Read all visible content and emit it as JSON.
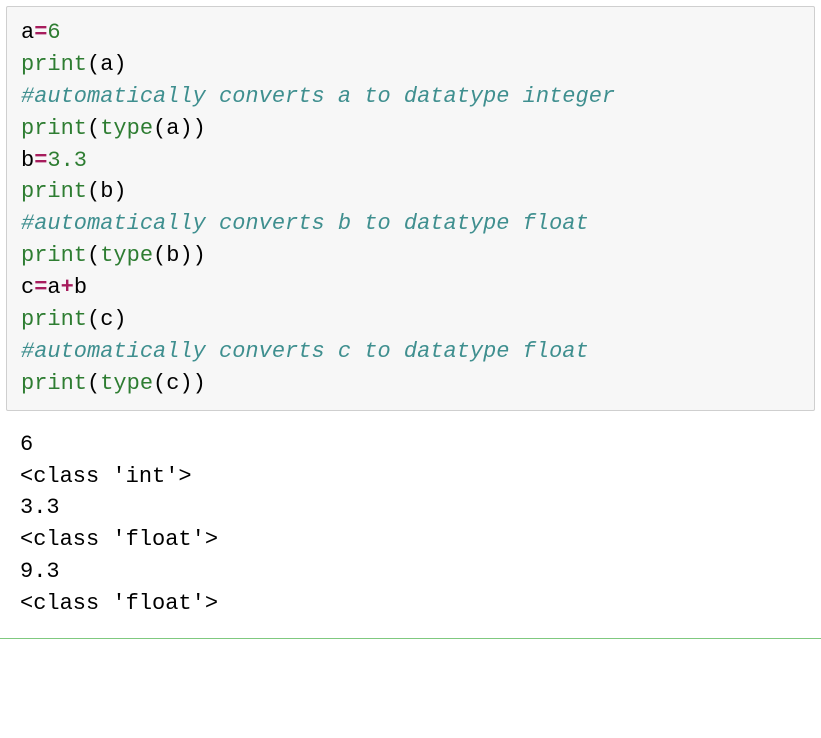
{
  "code": {
    "lines": [
      {
        "tokens": [
          {
            "cls": "tok-name",
            "t": "a"
          },
          {
            "cls": "tok-op",
            "t": "="
          },
          {
            "cls": "tok-num",
            "t": "6"
          }
        ]
      },
      {
        "tokens": [
          {
            "cls": "tok-builtin",
            "t": "print"
          },
          {
            "cls": "tok-paren",
            "t": "("
          },
          {
            "cls": "tok-name",
            "t": "a"
          },
          {
            "cls": "tok-paren",
            "t": ")"
          }
        ]
      },
      {
        "tokens": [
          {
            "cls": "tok-comment",
            "t": "#automatically converts a to datatype integer"
          }
        ]
      },
      {
        "tokens": [
          {
            "cls": "tok-builtin",
            "t": "print"
          },
          {
            "cls": "tok-paren",
            "t": "("
          },
          {
            "cls": "tok-builtin",
            "t": "type"
          },
          {
            "cls": "tok-paren",
            "t": "("
          },
          {
            "cls": "tok-name",
            "t": "a"
          },
          {
            "cls": "tok-paren",
            "t": ")"
          },
          {
            "cls": "tok-paren",
            "t": ")"
          }
        ]
      },
      {
        "tokens": [
          {
            "cls": "tok-name",
            "t": "b"
          },
          {
            "cls": "tok-op",
            "t": "="
          },
          {
            "cls": "tok-num",
            "t": "3.3"
          }
        ]
      },
      {
        "tokens": [
          {
            "cls": "tok-builtin",
            "t": "print"
          },
          {
            "cls": "tok-paren",
            "t": "("
          },
          {
            "cls": "tok-name",
            "t": "b"
          },
          {
            "cls": "tok-paren",
            "t": ")"
          }
        ]
      },
      {
        "tokens": [
          {
            "cls": "tok-comment",
            "t": "#automatically converts b to datatype float"
          }
        ]
      },
      {
        "tokens": [
          {
            "cls": "tok-builtin",
            "t": "print"
          },
          {
            "cls": "tok-paren",
            "t": "("
          },
          {
            "cls": "tok-builtin",
            "t": "type"
          },
          {
            "cls": "tok-paren",
            "t": "("
          },
          {
            "cls": "tok-name",
            "t": "b"
          },
          {
            "cls": "tok-paren",
            "t": ")"
          },
          {
            "cls": "tok-paren",
            "t": ")"
          }
        ]
      },
      {
        "tokens": [
          {
            "cls": "tok-name",
            "t": "c"
          },
          {
            "cls": "tok-op",
            "t": "="
          },
          {
            "cls": "tok-name",
            "t": "a"
          },
          {
            "cls": "tok-op",
            "t": "+"
          },
          {
            "cls": "tok-name",
            "t": "b"
          }
        ]
      },
      {
        "tokens": [
          {
            "cls": "tok-builtin",
            "t": "print"
          },
          {
            "cls": "tok-paren",
            "t": "("
          },
          {
            "cls": "tok-name",
            "t": "c"
          },
          {
            "cls": "tok-paren",
            "t": ")"
          }
        ]
      },
      {
        "tokens": [
          {
            "cls": "tok-comment",
            "t": "#automatically converts c to datatype float"
          }
        ]
      },
      {
        "tokens": [
          {
            "cls": "tok-builtin",
            "t": "print"
          },
          {
            "cls": "tok-paren",
            "t": "("
          },
          {
            "cls": "tok-builtin",
            "t": "type"
          },
          {
            "cls": "tok-paren",
            "t": "("
          },
          {
            "cls": "tok-name",
            "t": "c"
          },
          {
            "cls": "tok-paren",
            "t": ")"
          },
          {
            "cls": "tok-paren",
            "t": ")"
          }
        ]
      }
    ]
  },
  "output": {
    "lines": [
      "6",
      "<class 'int'>",
      "3.3",
      "<class 'float'>",
      "9.3",
      "<class 'float'>"
    ]
  }
}
